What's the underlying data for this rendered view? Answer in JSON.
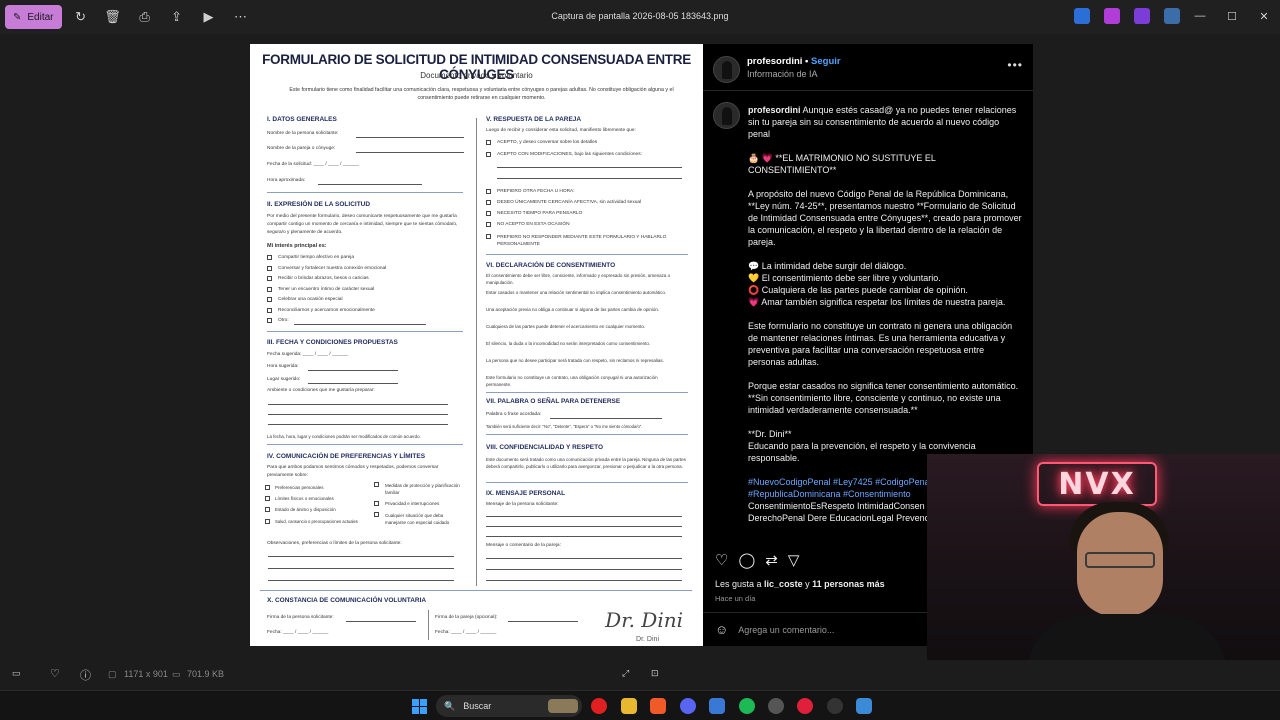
{
  "titlebar": {
    "edit_label": "Editar",
    "file_name": "Captura de pantalla 2026-08-05 183643.png"
  },
  "document": {
    "title": "FORMULARIO DE SOLICITUD DE INTIMIDAD CONSENSUADA ENTRE CÓNYUGES",
    "subtitle": "Documento privado y voluntario",
    "intro": "Este formulario tiene como finalidad facilitar una comunicación clara, respetuosa y voluntaria entre cónyuges o parejas adultas. No constituye obligación alguna y el consentimiento puede retirarse en cualquier momento.",
    "s1": "I. DATOS GENERALES",
    "s1_fields": [
      "Nombre de la persona solicitante:",
      "Nombre de la pareja o cónyuge:",
      "Fecha de la solicitud: ____ / ____ / ______",
      "Hora aproximada:"
    ],
    "s2": "II. EXPRESIÓN DE LA SOLICITUD",
    "s2_text": "Por medio del presente formulario, deseo comunicarte respetuosamente que me gustaría compartir contigo un momento de cercanía e intimidad, siempre que te sientas cómoda/o, segura/o y plenamente de acuerdo.",
    "s2_interest": "Mi interés principal es:",
    "s2_items": [
      "Compartir tiempo afectivo en pareja",
      "Conversar y fortalecer nuestra conexión emocional",
      "Recibir o brindar abrazos, besos o caricias",
      "Tener un encuentro íntimo de carácter sexual",
      "Celebrar una ocasión especial",
      "Reconciliarnos y acercarnos emocionalmente",
      "Otro:"
    ],
    "s3": "III. FECHA Y CONDICIONES PROPUESTAS",
    "s3_fields": [
      "Fecha sugerida: ____ / ____ / ______",
      "Hora sugerida:",
      "Lugar sugerido:",
      "Ambiente o condiciones que me gustaría preparar:"
    ],
    "s3_note": "La fecha, hora, lugar y condiciones podrán ser modificados de común acuerdo.",
    "s4": "IV. COMUNICACIÓN DE PREFERENCIAS Y LÍMITES",
    "s4_text": "Para que ambos podamos sentirnos cómodos y respetados, podemos conversar previamente sobre:",
    "s4_left": [
      "Preferencias personales",
      "Límites físicos o emocionales",
      "Estado de ánimo y disposición",
      "Salud, cansancio o preocupaciones actuales"
    ],
    "s4_right": [
      "Medidas de protección y planificación familiar",
      "Privacidad e interrupciones",
      "Cualquier situación que deba manejarse con especial cuidado"
    ],
    "s4_obs": "Observaciones, preferencias o límites de la persona solicitante:",
    "s5": "V. RESPUESTA DE LA PAREJA",
    "s5_text": "Luego de recibir y considerar esta solicitud, manifiesto libremente que:",
    "s5_items": [
      "ACEPTO, y deseo conversar sobre los detalles",
      "ACEPTO CON MODIFICACIONES, bajo las siguientes condiciones:",
      "PREFIERO OTRA FECHA U HORA:",
      "DESEO ÚNICAMENTE CERCANÍA AFECTIVA, sin actividad sexual",
      "NECESITO TIEMPO PARA PENSARLO",
      "NO ACEPTO EN ESTA OCASIÓN",
      "PREFIERO NO RESPONDER MEDIANTE ESTE FORMULARIO Y HABLARLO PERSONALMENTE"
    ],
    "s6": "VI. DECLARACIÓN DE CONSENTIMIENTO",
    "s6_items": [
      "El consentimiento debe ser libre, consciente, informado y expresado sin presión, amenaza o manipulación.",
      "Estar casados o mantener una relación sentimental no implica consentimiento automático.",
      "Una aceptación previa no obliga a continuar si alguna de las partes cambia de opinión.",
      "Cualquiera de las partes puede detener el acercamiento en cualquier momento.",
      "El silencio, la duda o la incomodidad no serán interpretados como consentimiento.",
      "La persona que no desee participar será tratada con respeto, sin reclamos ni represalias.",
      "Este formulario no constituye un contrato, una obligación conyugal ni una autorización permanente."
    ],
    "s7": "VII. PALABRA O SEÑAL PARA DETENERSE",
    "s7_field": "Palabra o frase acordada:",
    "s7_note": "También será suficiente decir: \"No\", \"Detente\", \"Espera\" o \"No me siento cómoda/o\".",
    "s8": "VIII. CONFIDENCIALIDAD Y RESPETO",
    "s8_text": "Este documento será tratado como una comunicación privada entre la pareja. Ninguna de las partes deberá compartirlo, publicarlo o utilizarlo para avergonzar, presionar o perjudicar a la otra persona.",
    "s9": "IX. MENSAJE PERSONAL",
    "s9_field1": "Mensaje de la persona solicitante:",
    "s9_field2": "Mensaje o comentario de la pareja:",
    "s10": "X. CONSTANCIA DE COMUNICACIÓN VOLUNTARIA",
    "s10_f1": "Firma de la persona solicitante:",
    "s10_f2": "Firma de la pareja (opcional):",
    "s10_date": "Fecha: ____ / ____ / ______",
    "signature": "Dr. Dini",
    "signature_name": "Dr. Dini"
  },
  "post": {
    "username": "profesordini",
    "follow": "Seguir",
    "subtitle": "Información de IA",
    "caption_user": "profesordini",
    "caption_intro": "Aunque estés casad@ ya no puedes tener relaciones sin tu pareja sin su consentimiento de acuerdo al nuevo código penal",
    "p1": "🎂 💗 **EL MATRIMONIO NO SUSTITUYE EL CONSENTIMIENTO**",
    "p2": "A propósito del nuevo Código Penal de la República Dominicana, **Ley núm. 74-25**, presentamos nuestro **Formulario de Solicitud de Intimidad Consensuada entre Cónyuges**, creado para promover la comunicación, el respeto y la libertad dentro de la relación de pareja.",
    "b1": "💬 La intimidad debe surgir del diálogo.",
    "b2": "💛 El consentimiento debe ser libre y voluntario.",
    "b3": "⭕ Cualquiera de las partes puede cambiar de opinión.",
    "b4": "💗 Amar también significa respetar los límites de nuestra pareja.",
    "p3": "Este formulario no constituye un contrato ni genera una obligación de mantener relaciones íntimas. Es una herramienta educativa y preventiva para facilitar una conversación respetuosa entre personas adultas.",
    "p4": "Porque estar casados no significa tener consentimiento automático. **Sin consentimiento libre, consciente y continuo, no existe una intimidad verdaderamente consensuada.**",
    "sig1": "**Dr. Dini**",
    "sig2": "Educando para la prevención, el respeto y la convivencia responsable.",
    "hashtags": "#NuevoCodigoPenal #Ley7425 #CodigoPenalDominicano #RepublicaDominicana #Consentimiento",
    "hashtags2": "ConsentimientoEsRespeto IntimidadConsen MatrimonioConRespeto DerechoPenal Dere EducacionLegal PrevencionLegal Derechos",
    "likes_prefix": "Les gusta a ",
    "likes_user": "lic_coste",
    "likes_mid": " y ",
    "likes_count": "11 personas más",
    "ago": "Hace un día",
    "comment_placeholder": "Agrega un comentario..."
  },
  "webcam": {
    "neon_text": "NVX"
  },
  "viewer": {
    "dimensions": "1171 x 901",
    "size": "701.9 KB"
  },
  "taskbar": {
    "search_label": "Buscar"
  }
}
